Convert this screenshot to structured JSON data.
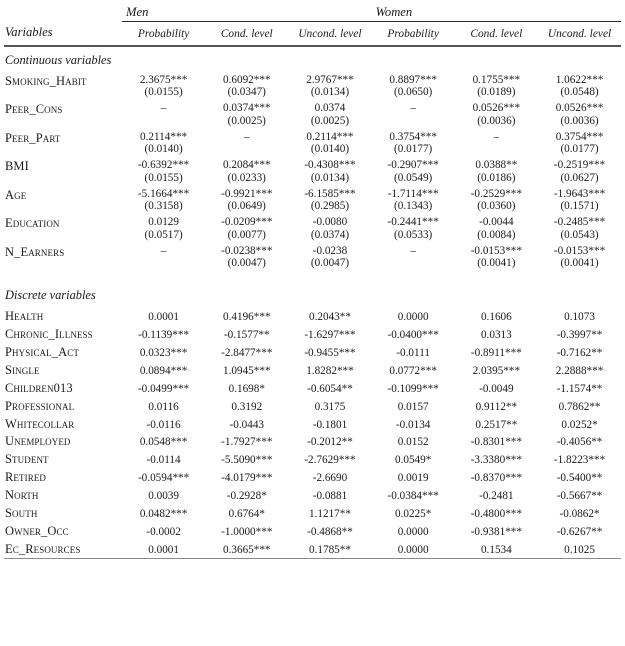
{
  "table": {
    "groups": [
      {
        "label": "Men"
      },
      {
        "label": "Women"
      }
    ],
    "variables_header": "Variables",
    "column_headers": [
      "Probability",
      "Cond. level",
      "Uncond. level",
      "Probability",
      "Cond. level",
      "Uncond. level"
    ],
    "sections": [
      {
        "title": "Continuous variables",
        "type": "two_line",
        "rows": [
          {
            "name": "Smoking_Habit",
            "coefs": [
              "2.3675***",
              "0.6092***",
              "2.9767***",
              "0.8897***",
              "0.1755***",
              "1.0622***"
            ],
            "ses": [
              "(0.0155)",
              "(0.0347)",
              "(0.0134)",
              "(0.0650)",
              "(0.0189)",
              "(0.0548)"
            ]
          },
          {
            "name": "Peer_Cons",
            "coefs": [
              "–",
              "0.0374***",
              "0.0374",
              "–",
              "0.0526***",
              "0.0526***"
            ],
            "ses": [
              "",
              "(0.0025)",
              "(0.0025)",
              "",
              "(0.0036)",
              "(0.0036)"
            ]
          },
          {
            "name": "Peer_Part",
            "coefs": [
              "0.2114***",
              "–",
              "0.2114***",
              "0.3754***",
              "–",
              "0.3754***"
            ],
            "ses": [
              "(0.0140)",
              "",
              "(0.0140)",
              "(0.0177)",
              "",
              "(0.0177)"
            ]
          },
          {
            "name": "BMI",
            "coefs": [
              "-0.6392***",
              "0.2084***",
              "-0.4308***",
              "-0.2907***",
              "0.0388**",
              "-0.2519***"
            ],
            "ses": [
              "(0.0155)",
              "(0.0233)",
              "(0.0134)",
              "(0.0549)",
              "(0.0186)",
              "(0.0627)"
            ]
          },
          {
            "name": "Age",
            "coefs": [
              "-5.1664***",
              "-0.9921***",
              "-6.1585***",
              "-1.7114***",
              "-0.2529***",
              "-1.9643***"
            ],
            "ses": [
              "(0.3158)",
              "(0.0649)",
              "(0.2985)",
              "(0.1343)",
              "(0.0360)",
              "(0.1571)"
            ]
          },
          {
            "name": "Education",
            "coefs": [
              "0.0129",
              "-0.0209***",
              "-0.0080",
              "-0.2441***",
              "-0.0044",
              "-0.2485***"
            ],
            "ses": [
              "(0.0517)",
              "(0.0077)",
              "(0.0374)",
              "(0.0533)",
              "(0.0084)",
              "(0.0543)"
            ]
          },
          {
            "name": "N_Earners",
            "coefs": [
              "–",
              "-0.0238***",
              "-0.0238",
              "–",
              "-0.0153***",
              "-0.0153***"
            ],
            "ses": [
              "",
              "(0.0047)",
              "(0.0047)",
              "",
              "(0.0041)",
              "(0.0041)"
            ]
          }
        ]
      },
      {
        "title": "Discrete variables",
        "type": "one_line",
        "rows": [
          {
            "name": "Health",
            "values": [
              "0.0001",
              "0.4196***",
              "0.2043**",
              "0.0000",
              "0.1606",
              "0.1073"
            ]
          },
          {
            "name": "Chronic_Illness",
            "values": [
              "-0.1139***",
              "-0.1577**",
              "-1.6297***",
              "-0.0400***",
              "0.0313",
              "-0.3997**"
            ]
          },
          {
            "name": "Physical_Act",
            "values": [
              "0.0323***",
              "-2.8477***",
              "-0.9455***",
              "-0.0111",
              "-0.8911***",
              "-0.7162**"
            ]
          },
          {
            "name": "Single",
            "values": [
              "0.0894***",
              "1.0945***",
              "1.8282***",
              "0.0772***",
              "2.0395***",
              "2.2888***"
            ]
          },
          {
            "name": "Children013",
            "values": [
              "-0.0499***",
              "0.1698*",
              "-0.6054**",
              "-0.1099***",
              "-0.0049",
              "-1.1574**"
            ]
          },
          {
            "name": "Professional",
            "values": [
              "0.0116",
              "0.3192",
              "0.3175",
              "0.0157",
              "0.9112**",
              "0.7862**"
            ]
          },
          {
            "name": "Whitecollar",
            "values": [
              "-0.0116",
              "-0.0443",
              "-0.1801",
              "-0.0134",
              "0.2517**",
              "0.0252*"
            ]
          },
          {
            "name": "Unemployed",
            "values": [
              "0.0548***",
              "-1.7927***",
              "-0.2012**",
              "0.0152",
              "-0.8301***",
              "-0.4056**"
            ]
          },
          {
            "name": "Student",
            "values": [
              "-0.0114",
              "-5.5090***",
              "-2.7629***",
              "0.0549*",
              "-3.3380***",
              "-1.8223***"
            ]
          },
          {
            "name": "Retired",
            "values": [
              "-0.0594***",
              "-4.0179***",
              "-2.6690",
              "0.0019",
              "-0.8370***",
              "-0.5400**"
            ]
          },
          {
            "name": "North",
            "values": [
              "0.0039",
              "-0.2928*",
              "-0.0881",
              "-0.0384***",
              "-0.2481",
              "-0.5667**"
            ]
          },
          {
            "name": "South",
            "values": [
              "0.0482***",
              "0.6764*",
              "1.1217**",
              "0.0225*",
              "-0.4800***",
              "-0.0862*"
            ]
          },
          {
            "name": "Owner_Occ",
            "values": [
              "-0.0002",
              "-1.0000***",
              "-0.4868**",
              "0.0000",
              "-0.9381***",
              "-0.6267**"
            ]
          },
          {
            "name": "Ec_Resources",
            "values": [
              "0.0001",
              "0.3665***",
              "0.1785**",
              "0.0000",
              "0.1534",
              "0.1025"
            ]
          }
        ]
      }
    ]
  }
}
